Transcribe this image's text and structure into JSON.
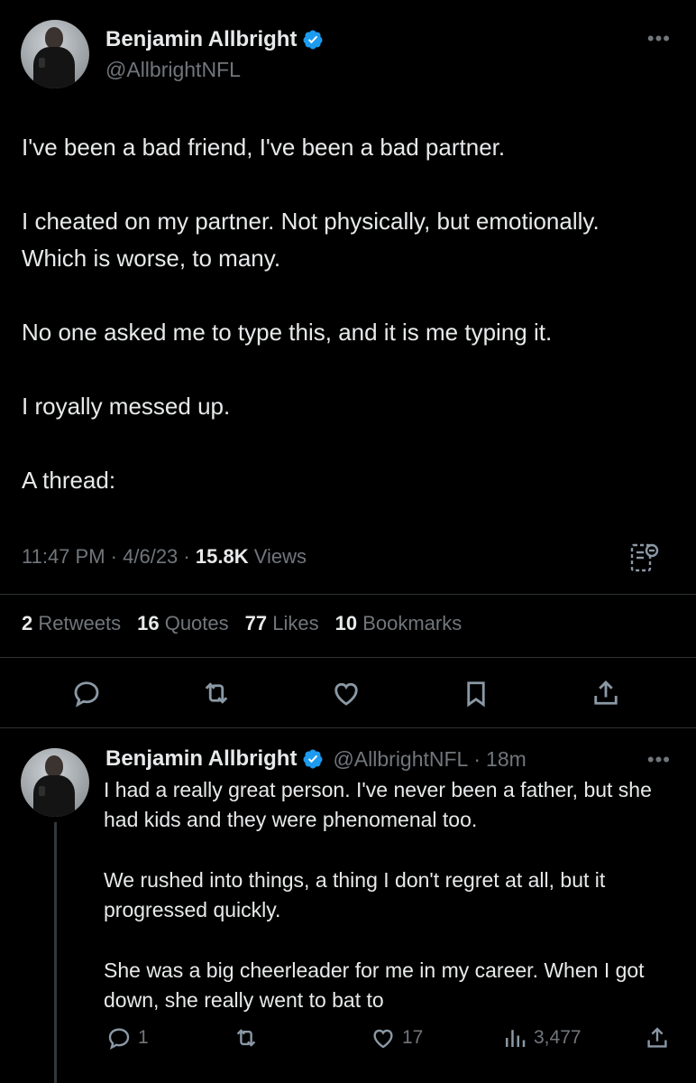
{
  "main_tweet": {
    "author_name": "Benjamin Allbright",
    "author_handle": "@AllbrightNFL",
    "more_label": "•••",
    "paragraphs": [
      "I've been a bad friend, I've been a bad partner.",
      "I cheated on my partner. Not physically, but emotionally. Which is worse, to many.",
      "No one asked me to type this, and it is me typing it.",
      "I royally messed up.",
      "A thread:"
    ],
    "time": "11:47 PM",
    "date": "4/6/23",
    "separator": "·",
    "views_count": "15.8K",
    "views_label": "Views",
    "stats": {
      "retweets_count": "2",
      "retweets_label": "Retweets",
      "quotes_count": "16",
      "quotes_label": "Quotes",
      "likes_count": "77",
      "likes_label": "Likes",
      "bookmarks_count": "10",
      "bookmarks_label": "Bookmarks"
    },
    "action_icons": [
      "reply-icon",
      "retweet-icon",
      "like-icon",
      "bookmark-icon",
      "share-icon"
    ]
  },
  "reply_tweet": {
    "author_name": "Benjamin Allbright",
    "author_handle": "@AllbrightNFL",
    "age": "18m",
    "separator": "·",
    "more_label": "•••",
    "paragraphs": [
      "I had a really great person. I've never been a father, but she had kids and they were phenomenal too.",
      "We rushed into things, a thing I don't regret at all, but it progressed quickly.",
      "She was a big cheerleader for me in my career. When I got down, she really went to bat to"
    ],
    "reply_count": "1",
    "retweet_count": "",
    "like_count": "17",
    "views_count": "3,477"
  },
  "colors": {
    "background": "#000000",
    "text": "#e7e9ea",
    "secondary": "#71767b",
    "verified": "#1d9bf0",
    "divider": "#2f3336"
  }
}
